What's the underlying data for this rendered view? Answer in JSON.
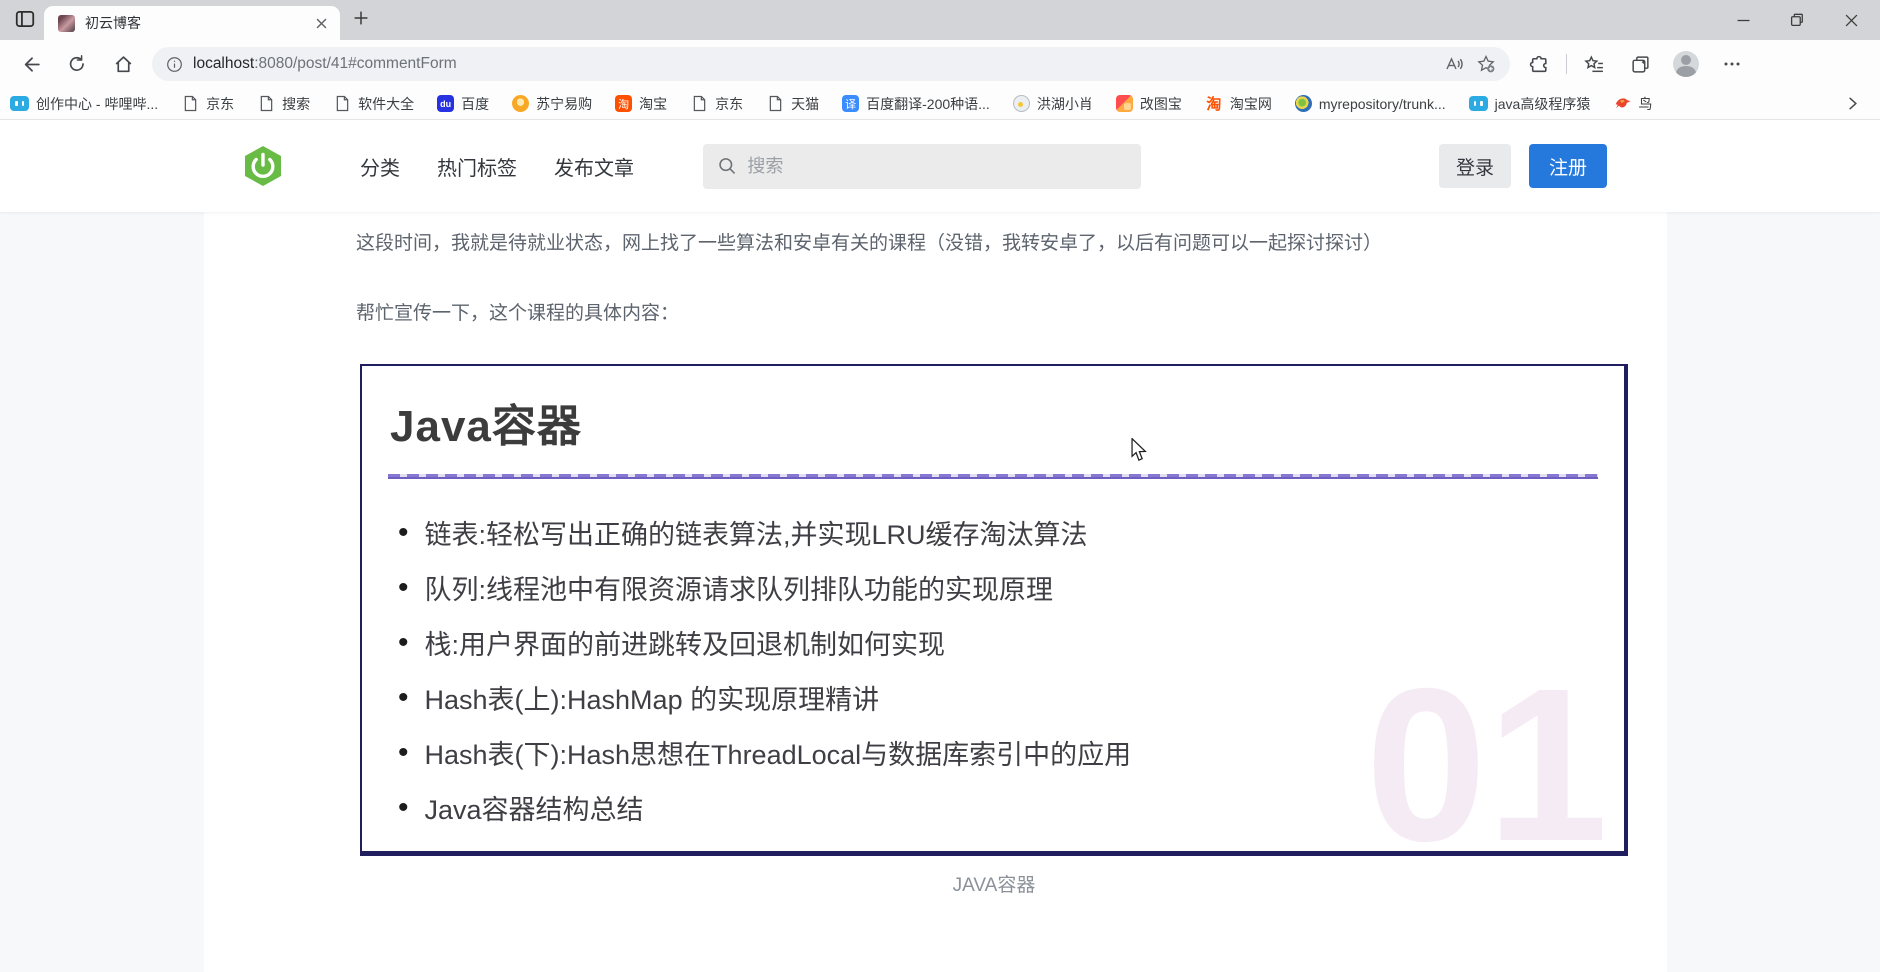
{
  "browser": {
    "tab_title": "初云博客",
    "url_host": "localhost",
    "url_rest": ":8080/post/41#commentForm"
  },
  "bookmarks": [
    {
      "label": "创作中心 - 哔哩哔...",
      "glyph": ""
    },
    {
      "label": "京东",
      "glyph": ""
    },
    {
      "label": "搜索",
      "glyph": ""
    },
    {
      "label": "软件大全",
      "glyph": ""
    },
    {
      "label": "百度",
      "glyph": "du"
    },
    {
      "label": "苏宁易购",
      "glyph": ""
    },
    {
      "label": "淘宝",
      "glyph": "淘"
    },
    {
      "label": "京东",
      "glyph": ""
    },
    {
      "label": "天猫",
      "glyph": ""
    },
    {
      "label": "百度翻译-200种语...",
      "glyph": "译"
    },
    {
      "label": "洪湖小肖",
      "glyph": ""
    },
    {
      "label": "改图宝",
      "glyph": ""
    },
    {
      "label": "淘宝网",
      "glyph": "淘"
    },
    {
      "label": "myrepository/trunk...",
      "glyph": ""
    },
    {
      "label": "java高级程序猿",
      "glyph": ""
    },
    {
      "label": "鸟",
      "glyph": ""
    }
  ],
  "site_header": {
    "nav": [
      {
        "label": "分类"
      },
      {
        "label": "热门标签"
      },
      {
        "label": "发布文章"
      }
    ],
    "search_placeholder": "搜索",
    "login": "登录",
    "register": "注册"
  },
  "article": {
    "paragraph1": "这段时间，我就是待就业状态，网上找了一些算法和安卓有关的课程（没错，我转安卓了，以后有问题可以一起探讨探讨）",
    "paragraph2": "帮忙宣传一下，这个课程的具体内容：",
    "course_card": {
      "title": "Java容器",
      "bullets": [
        "链表:轻松写出正确的链表算法,并实现LRU缓存淘汰算法",
        "队列:线程池中有限资源请求队列排队功能的实现原理",
        "栈:用户界面的前进跳转及回退机制如何实现",
        "Hash表(上):HashMap 的实现原理精讲",
        "Hash表(下):Hash思想在ThreadLocal与数据库索引中的应用",
        "Java容器结构总结"
      ],
      "watermark": "01",
      "caption": "JAVA容器"
    }
  },
  "colors": {
    "register_blue": "#2579dc",
    "spring_green": "#68bc45",
    "divider_purple": "#8677d2",
    "course_border_navy": "#201e5e",
    "watermark_pink": "#f5ebf4"
  }
}
